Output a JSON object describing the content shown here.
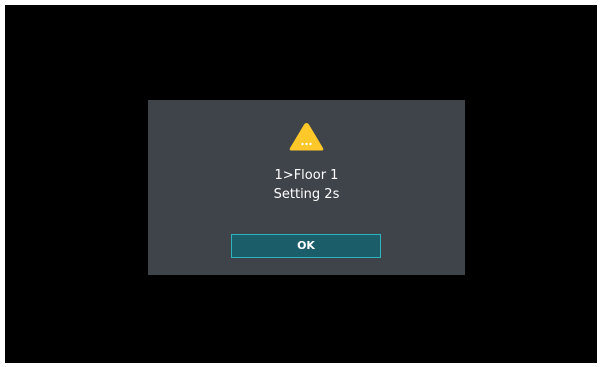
{
  "dialog": {
    "icon": "warning-triangle-icon",
    "icon_color": "#ffc82a",
    "message_line1": "1>Floor 1",
    "message_line2": "Setting 2s",
    "ok_label": "OK"
  },
  "colors": {
    "screen_background": "#000000",
    "dialog_background": "#3f434a",
    "button_fill": "#1b5e69",
    "button_border": "#2fb3bd"
  }
}
